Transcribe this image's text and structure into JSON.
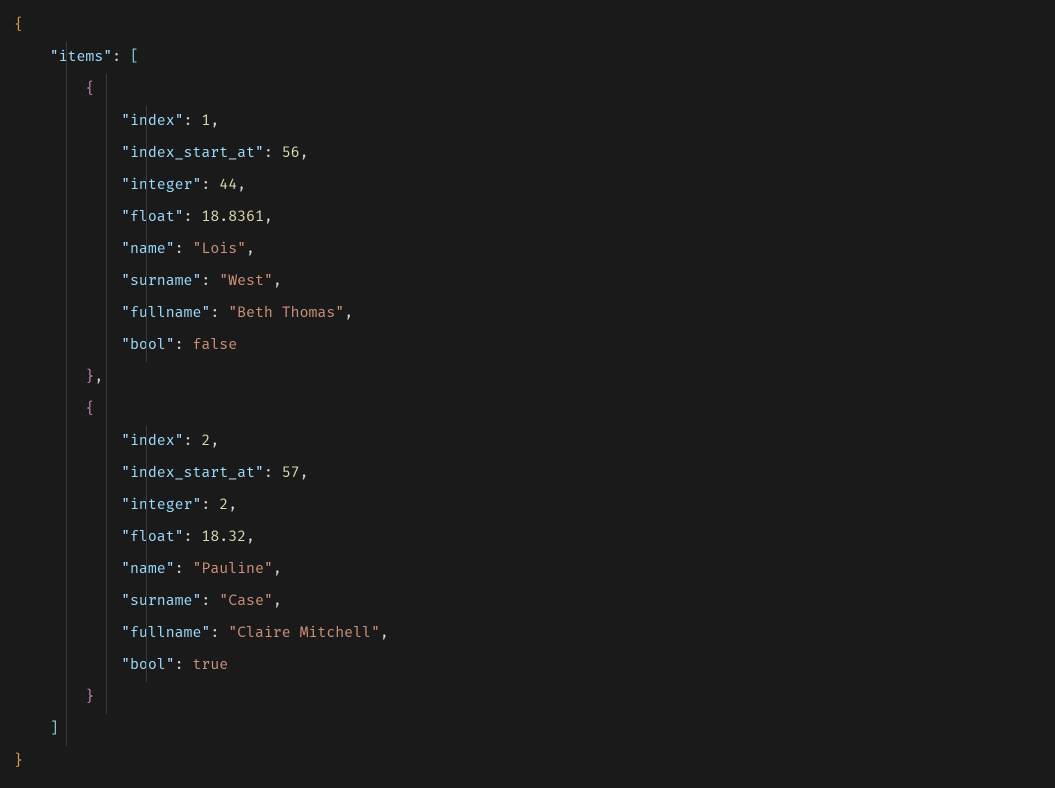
{
  "code": {
    "root_key": "items",
    "objects": [
      {
        "props": [
          {
            "key": "index",
            "type": "num",
            "val": "1"
          },
          {
            "key": "index_start_at",
            "type": "num",
            "val": "56"
          },
          {
            "key": "integer",
            "type": "num",
            "val": "44"
          },
          {
            "key": "float",
            "type": "num",
            "val": "18.8361"
          },
          {
            "key": "name",
            "type": "str",
            "val": "Lois"
          },
          {
            "key": "surname",
            "type": "str",
            "val": "West"
          },
          {
            "key": "fullname",
            "type": "str",
            "val": "Beth Thomas"
          },
          {
            "key": "bool",
            "type": "bool",
            "val": "false"
          }
        ]
      },
      {
        "props": [
          {
            "key": "index",
            "type": "num",
            "val": "2"
          },
          {
            "key": "index_start_at",
            "type": "num",
            "val": "57"
          },
          {
            "key": "integer",
            "type": "num",
            "val": "2"
          },
          {
            "key": "float",
            "type": "num",
            "val": "18.32"
          },
          {
            "key": "name",
            "type": "str",
            "val": "Pauline"
          },
          {
            "key": "surname",
            "type": "str",
            "val": "Case"
          },
          {
            "key": "fullname",
            "type": "str",
            "val": "Claire Mitchell"
          },
          {
            "key": "bool",
            "type": "bool",
            "val": "true"
          }
        ]
      }
    ]
  },
  "indent": {
    "unit": "    ",
    "guide_cols": [
      52,
      92,
      132
    ]
  }
}
